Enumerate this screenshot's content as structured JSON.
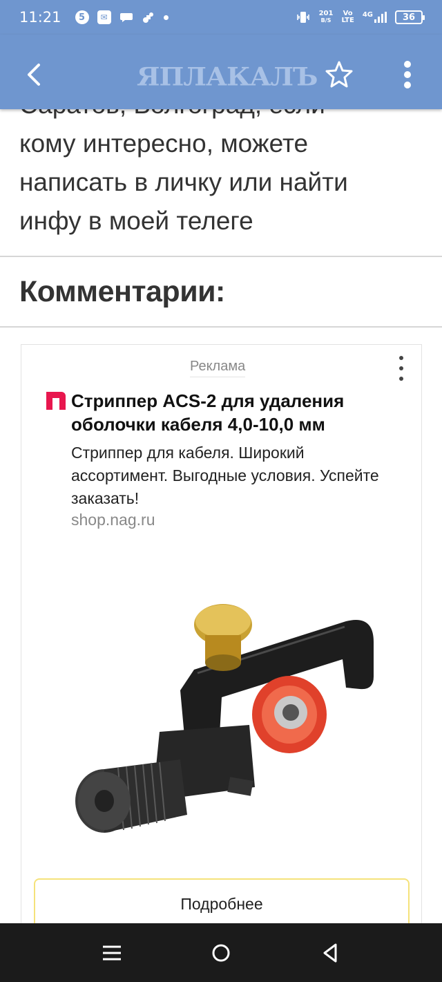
{
  "status_bar": {
    "time": "11:21",
    "net_speed_value": "201",
    "net_speed_unit": "B/S",
    "volte_top": "Vo",
    "volte_bottom": "LTE",
    "network": "4G",
    "battery": "36"
  },
  "app_bar": {
    "logo_text": "ЯПЛАКАЛЪ",
    "colors": {
      "background": "#6f96cf",
      "logo": "#a8c1e6"
    }
  },
  "post": {
    "text_lines": [
      "Саратов, Волгоград, если",
      "кому интересно, можете",
      "написать в личку или найти",
      "инфу в моей телеге"
    ]
  },
  "comments": {
    "title": "Комментарии:"
  },
  "ad": {
    "label": "Реклама",
    "title": "Стриппер ACS-2 для удаления оболочки кабеля 4,0-10,0 мм",
    "description": "Стриппер для кабеля. Широкий ассортимент. Выгодные условия. Успейте заказать!",
    "domain": "shop.nag.ru",
    "button_label": "Подробнее",
    "favicon_color": "#e8174e",
    "button_border_color": "#f5e27a"
  },
  "nav_bar": {
    "icons": [
      "recent-apps-icon",
      "home-icon",
      "back-triangle-icon"
    ]
  }
}
